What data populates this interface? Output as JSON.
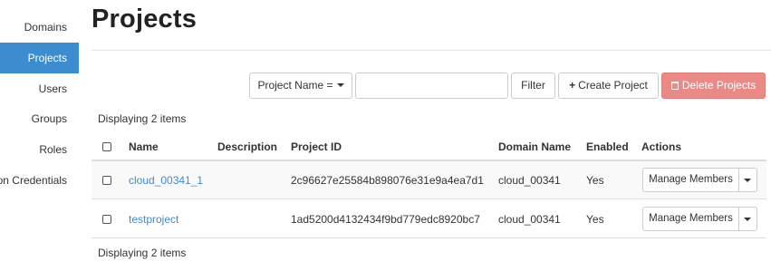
{
  "sidebar": {
    "items": [
      {
        "label": "Domains",
        "active": false
      },
      {
        "label": "Projects",
        "active": true
      },
      {
        "label": "Users",
        "active": false
      },
      {
        "label": "Groups",
        "active": false
      },
      {
        "label": "Roles",
        "active": false
      },
      {
        "label": "on Credentials",
        "active": false
      }
    ]
  },
  "header": {
    "title": "Projects"
  },
  "toolbar": {
    "filter_field_label": "Project Name =",
    "search_value": "",
    "search_placeholder": "",
    "filter_label": "Filter",
    "create_label": "Create Project",
    "delete_label": "Delete Projects"
  },
  "table": {
    "count_text_top": "Displaying 2 items",
    "count_text_bottom": "Displaying 2 items",
    "columns": [
      "Name",
      "Description",
      "Project ID",
      "Domain Name",
      "Enabled",
      "Actions"
    ],
    "rows": [
      {
        "name": "cloud_00341_1",
        "description": "",
        "project_id": "2c96627e25584b898076e31e9a4ea7d1",
        "domain_name": "cloud_00341",
        "enabled": "Yes",
        "action_label": "Manage Members"
      },
      {
        "name": "testproject",
        "description": "",
        "project_id": "1ad5200d4132434f9bd779edc8920bc7",
        "domain_name": "cloud_00341",
        "enabled": "Yes",
        "action_label": "Manage Members"
      }
    ]
  },
  "colors": {
    "accent": "#3c8dd0",
    "danger": "#ea8a87",
    "row_stripe": "#f9f9f9"
  },
  "icons": {
    "create": "plus-icon",
    "delete": "trash-icon",
    "dropdown": "caret-down-icon"
  }
}
